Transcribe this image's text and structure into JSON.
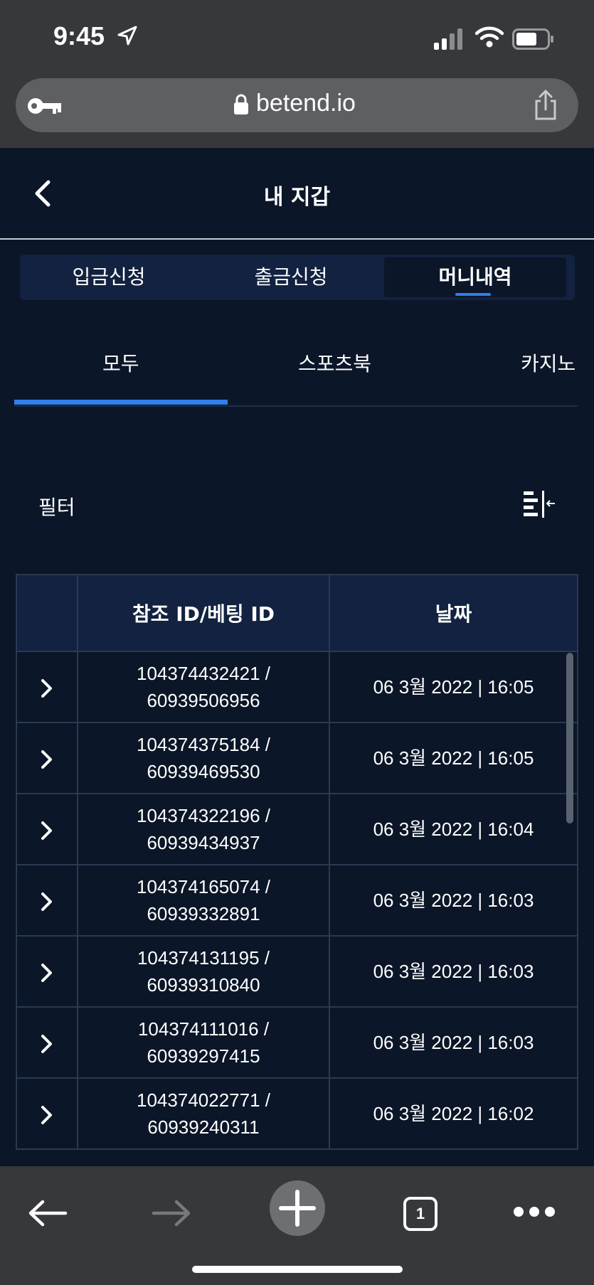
{
  "status_bar": {
    "time": "9:45"
  },
  "browser": {
    "url": "betend.io"
  },
  "header": {
    "title": "내 지갑"
  },
  "wallet_tabs": [
    {
      "label": "입금신청",
      "active": false
    },
    {
      "label": "출금신청",
      "active": false
    },
    {
      "label": "머니내역",
      "active": true
    }
  ],
  "sub_tabs": [
    {
      "label": "모두",
      "active": true
    },
    {
      "label": "스포츠북",
      "active": false
    },
    {
      "label": "카지노",
      "active": false
    }
  ],
  "filter": {
    "label": "필터"
  },
  "table": {
    "columns": [
      "",
      "참조 ID/베팅 ID",
      "날짜"
    ],
    "rows": [
      {
        "ref": "104374432421 /",
        "bet": "60939506956",
        "date": "06 3월 2022 | 16:05"
      },
      {
        "ref": "104374375184 /",
        "bet": "60939469530",
        "date": "06 3월 2022 | 16:05"
      },
      {
        "ref": "104374322196 /",
        "bet": "60939434937",
        "date": "06 3월 2022 | 16:04"
      },
      {
        "ref": "104374165074 /",
        "bet": "60939332891",
        "date": "06 3월 2022 | 16:03"
      },
      {
        "ref": "104374131195 /",
        "bet": "60939310840",
        "date": "06 3월 2022 | 16:03"
      },
      {
        "ref": "104374111016 /",
        "bet": "60939297415",
        "date": "06 3월 2022 | 16:03"
      },
      {
        "ref": "104374022771 /",
        "bet": "60939240311",
        "date": "06 3월 2022 | 16:02"
      }
    ]
  },
  "bottom_bar": {
    "tab_count": "1"
  },
  "colors": {
    "background": "#0b1628",
    "accent": "#2f7fe8",
    "header_row": "#122240",
    "chrome": "#37383b"
  }
}
